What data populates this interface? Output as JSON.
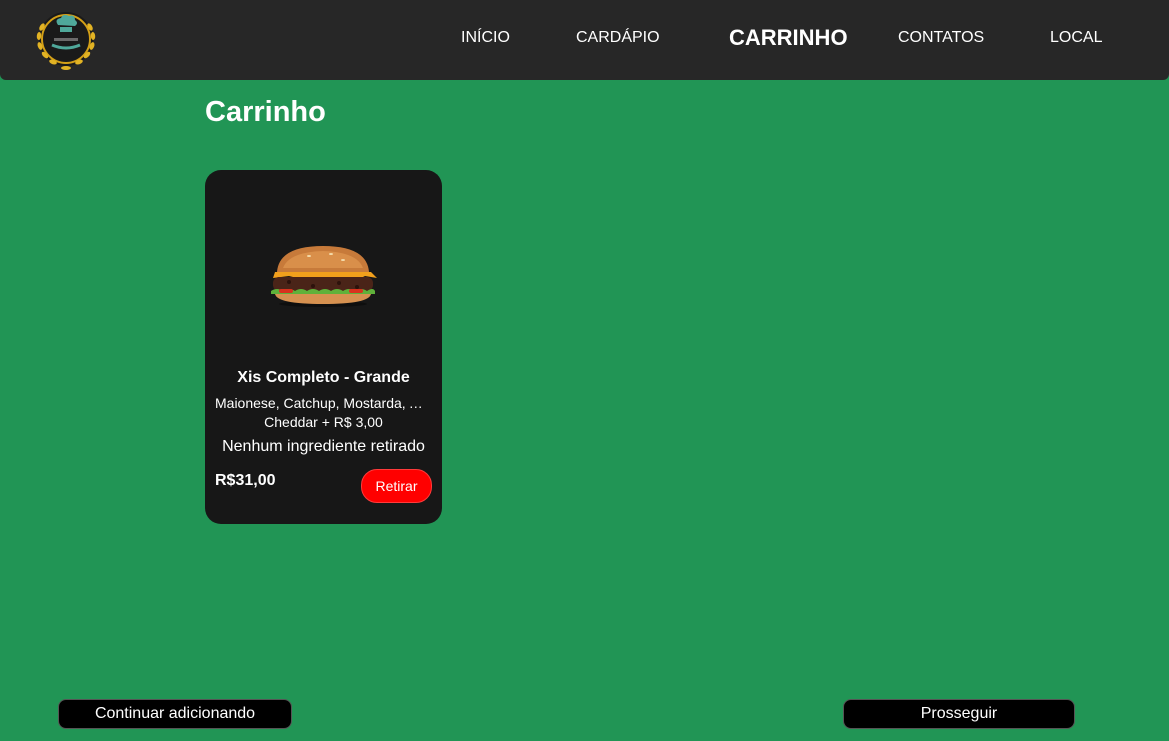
{
  "nav": {
    "logo_icon": "restaurant-logo-icon",
    "items": [
      {
        "label": "INÍCIO",
        "active": false
      },
      {
        "label": "CARDÁPIO",
        "active": false
      },
      {
        "label": "CARRINHO",
        "active": true
      },
      {
        "label": "CONTATOS",
        "active": false
      },
      {
        "label": "LOCAL",
        "active": false
      }
    ]
  },
  "page": {
    "title": "Carrinho"
  },
  "cart": {
    "items": [
      {
        "image_icon": "burger-image",
        "name": "Xis Completo - Grande",
        "description": "Maionese, Catchup, Mostarda, Alface, Tomate",
        "extra": "Cheddar + R$ 3,00",
        "removed": "Nenhum ingrediente retirado",
        "price": "R$31,00",
        "remove_label": "Retirar"
      }
    ]
  },
  "actions": {
    "continue_label": "Continuar adicionando",
    "proceed_label": "Prosseguir"
  },
  "colors": {
    "background": "#219555",
    "navbar": "#272727",
    "card": "#171717",
    "remove_button": "#ff0000",
    "bottom_button": "#000000"
  }
}
